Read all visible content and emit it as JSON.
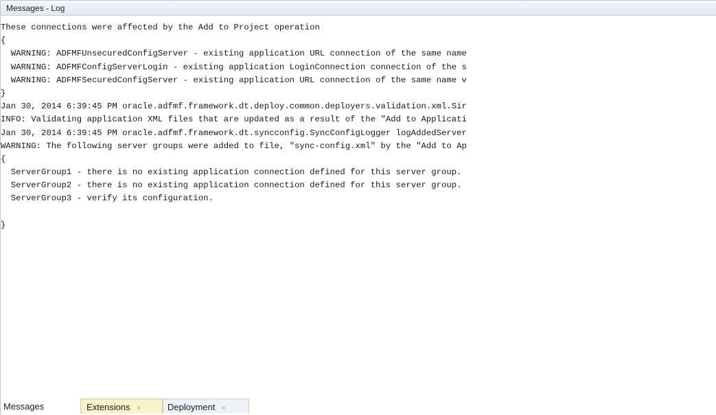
{
  "window": {
    "title": "Messages - Log"
  },
  "log_lines": [
    "These connections were affected by the Add to Project operation",
    "{",
    "  WARNING: ADFMFUnsecuredConfigServer - existing application URL connection of the same name",
    "  WARNING: ADFMFConfigServerLogin - existing application LoginConnection connection of the s",
    "  WARNING: ADFMFSecuredConfigServer - existing application URL connection of the same name v",
    "}",
    "Jan 30, 2014 6:39:45 PM oracle.adfmf.framework.dt.deploy.common.deployers.validation.xml.Sir",
    "INFO: Validating application XML files that are updated as a result of the \"Add to Applicati",
    "Jan 30, 2014 6:39:45 PM oracle.adfmf.framework.dt.syncconfig.SyncConfigLogger logAddedServer",
    "WARNING: The following server groups were added to file, \"sync-config.xml\" by the \"Add to Ap",
    "{",
    "  ServerGroup1 - there is no existing application connection defined for this server group.",
    "  ServerGroup2 - there is no existing application connection defined for this server group.",
    "  ServerGroup3 - verify its configuration.",
    "",
    "}"
  ],
  "tabs": [
    {
      "label": "Messages",
      "closable": false
    },
    {
      "label": "Extensions",
      "closable": true,
      "close_glyph": "×"
    },
    {
      "label": "Deployment",
      "closable": true,
      "close_glyph": "×"
    }
  ]
}
